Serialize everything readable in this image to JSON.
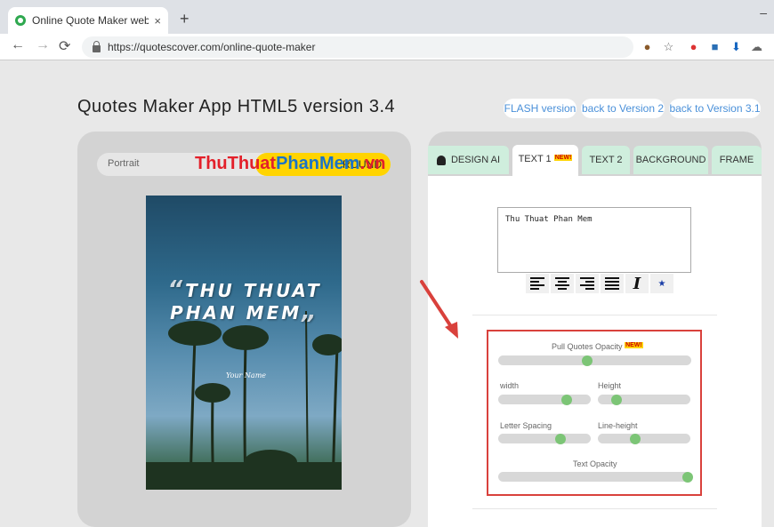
{
  "browser": {
    "tab_title": "Online Quote Maker web applica",
    "tab_close": "×",
    "new_tab": "+",
    "minimize": "–",
    "url": "https://quotescover.com/online-quote-maker"
  },
  "page": {
    "title": "Quotes Maker App HTML5 version 3.4",
    "version_links": [
      "FLASH version",
      "back to Version 2",
      "back to Version 3.1"
    ]
  },
  "left": {
    "toggle_portrait": "Portrait",
    "toggle_background": "ROUND",
    "watermark": [
      "ThuThuat",
      "PhanMem",
      ".vn"
    ],
    "quote_open": "“",
    "quote_line1": "THU THUAT",
    "quote_line2": "PHAN MEM",
    "quote_close": "„",
    "your_name": "Your Name"
  },
  "right": {
    "tabs": [
      {
        "label": "DESIGN AI"
      },
      {
        "label": "TEXT 1",
        "badge": "NEW!"
      },
      {
        "label": "TEXT 2"
      },
      {
        "label": "BACKGROUND"
      },
      {
        "label": "FRAME"
      }
    ],
    "textarea_value": "Thu Thuat Phan Mem",
    "italic_glyph": "I",
    "star_glyph": "★",
    "sliders": {
      "pull_quotes_opacity": {
        "label": "Pull Quotes Opacity",
        "badge": "NEW!",
        "value": 0.46
      },
      "width": {
        "label": "width",
        "value": 0.74
      },
      "height": {
        "label": "Height",
        "value": 0.2
      },
      "letter_spacing": {
        "label": "Letter Spacing",
        "value": 0.67
      },
      "line_height": {
        "label": "Line-height",
        "value": 0.4
      },
      "text_opacity": {
        "label": "Text Opacity",
        "value": 0.98
      }
    }
  },
  "colors": {
    "accent_yellow": "#ffd400",
    "tab_green": "#cfeedd",
    "knob_green": "#7cc576",
    "annotation_red": "#d9413c",
    "link_blue": "#4a90d9"
  }
}
